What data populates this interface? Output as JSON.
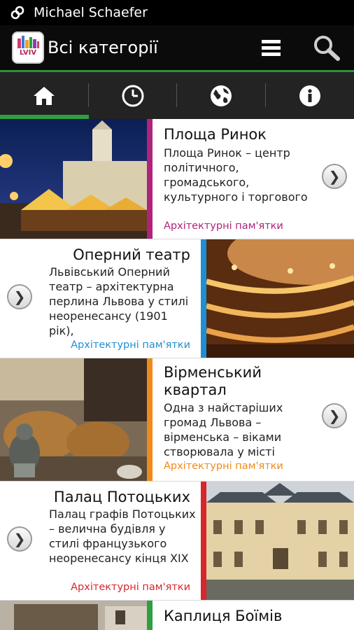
{
  "status_bar": {
    "user_name": "Michael Schaefer"
  },
  "action_bar": {
    "logo_text": "LVIV",
    "title": "Всі категорії"
  },
  "tabs": [
    {
      "name": "home",
      "icon": "home-icon",
      "active": true
    },
    {
      "name": "history",
      "icon": "clock-icon",
      "active": false
    },
    {
      "name": "world",
      "icon": "globe-icon",
      "active": false
    },
    {
      "name": "info",
      "icon": "info-icon",
      "active": false
    }
  ],
  "colors": {
    "accent_green": "#2f9e42",
    "magenta": "#b0237c",
    "blue": "#1f8fd1",
    "orange": "#f08a1c",
    "red": "#d7262c"
  },
  "items": [
    {
      "title": "Площа Ринок",
      "description": "Площа Ринок – центр політичного, громадського, культурного і торгового",
      "category": "Архітектурні пам'ятки",
      "accent": "#b0237c",
      "image": "rynok-square-photo"
    },
    {
      "title": "Оперний театр",
      "description": "Львівський Оперний театр – архітектурна перлина Львова у стилі неоренесансу (1901 рік),",
      "category": "Архітектурні пам'ятки",
      "accent": "#1f8fd1",
      "image": "opera-theatre-photo"
    },
    {
      "title": "Вірменський квартал",
      "description": "Одна з найстаріших громад Львова – вірменська – віками створювала у місті",
      "category": "Архітектурні пам'ятки",
      "accent": "#f08a1c",
      "image": "armenian-quarter-photo"
    },
    {
      "title": "Палац Потоцьких",
      "description": "Палац графів Потоцьких – велична будівля у стилі французького неоренесансу кінця XIX",
      "category": "Архітектурні пам'ятки",
      "accent": "#d7262c",
      "image": "potocki-palace-photo"
    },
    {
      "title": "Каплиця Боїмів",
      "description": "",
      "category": "",
      "accent": "#2f9e42",
      "image": "boim-chapel-photo"
    }
  ]
}
